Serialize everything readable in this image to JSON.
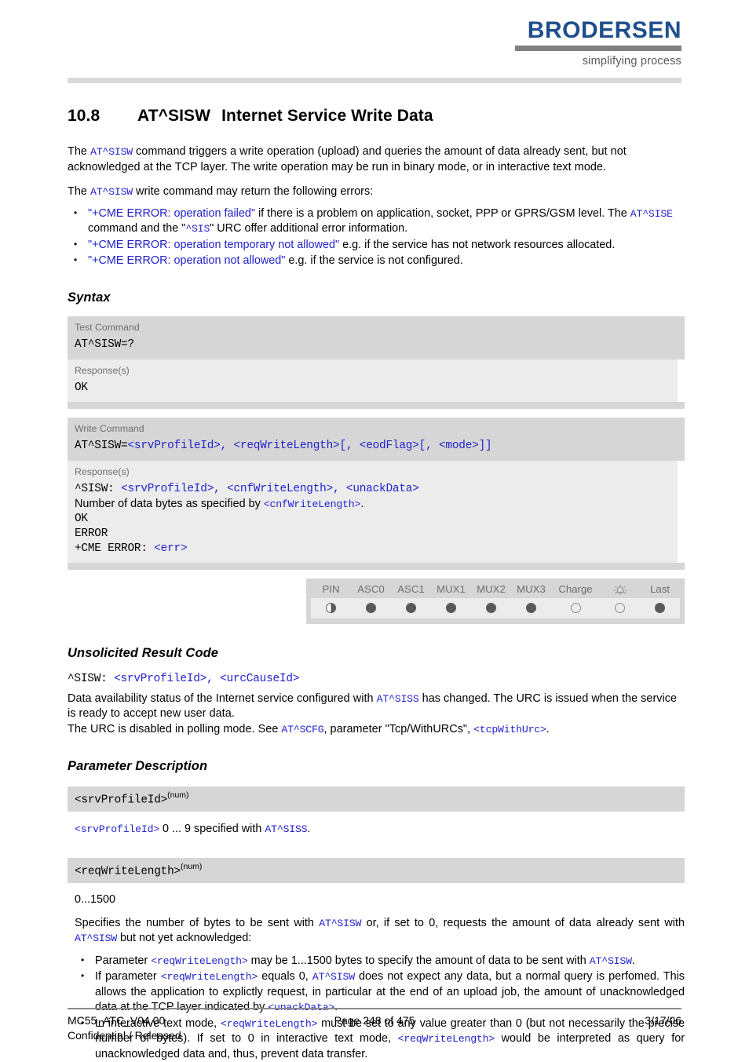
{
  "header": {
    "logo_word": "BRODERSEN",
    "logo_tagline": "simplifying process",
    "logo_color": "#1f4e8c"
  },
  "section": {
    "number": "10.8",
    "command": "AT^SISW",
    "title": "Internet Service Write Data"
  },
  "intro": {
    "p1_a": "The ",
    "p1_code": "AT^SISW",
    "p1_b": " command triggers a write operation (upload) and queries the amount of data already sent, but not acknowledged at the TCP layer. The write operation may be run in binary mode, or in interactive text mode.",
    "p2_a": "The ",
    "p2_code": "AT^SISW",
    "p2_b": " write command may return the following errors:"
  },
  "error_bullets": [
    {
      "quoted": "\"+CME ERROR: operation failed\"",
      "rest": " if there is a problem on application, socket, PPP or GPRS/GSM level. The ",
      "code2": "AT^SISE",
      "rest2": " command and the \"",
      "code3": "^SIS",
      "rest3": "\" URC offer additional error information."
    },
    {
      "quoted": "\"+CME ERROR: operation temporary not allowed\"",
      "rest": " e.g. if the service has not network resources allocated."
    },
    {
      "quoted": "\"+CME ERROR: operation not allowed\"",
      "rest": " e.g. if the service is not configured."
    }
  ],
  "syntax": {
    "heading": "Syntax",
    "test_command": {
      "label": "Test Command",
      "code": "AT^SISW=?",
      "response_label": "Response(s)",
      "response": "OK"
    },
    "write_command": {
      "label": "Write Command",
      "code_prefix": "AT^SISW=",
      "code_params": "<srvProfileId>, <reqWriteLength>[, <eodFlag>[, <mode>]]",
      "response_label": "Response(s)",
      "response_line1_prefix": "^SISW: ",
      "response_line1_params": "<srvProfileId>, <cnfWriteLength>, <unackData>",
      "response_line2_a": "Number of data bytes as specified by ",
      "response_line2_code": "<cnfWriteLength>",
      "response_line2_b": ".",
      "response_line3": "OK",
      "response_line4": "ERROR",
      "response_line5_prefix": "+CME ERROR: ",
      "response_line5_code": "<err>"
    }
  },
  "capability": {
    "columns": [
      {
        "label": "PIN",
        "state": "half"
      },
      {
        "label": "ASC0",
        "state": "full"
      },
      {
        "label": "ASC1",
        "state": "full"
      },
      {
        "label": "MUX1",
        "state": "full"
      },
      {
        "label": "MUX2",
        "state": "full"
      },
      {
        "label": "MUX3",
        "state": "full"
      },
      {
        "label": "Charge",
        "state": "empty"
      },
      {
        "label": "",
        "icon": "alarm-bell-icon",
        "state": "empty"
      },
      {
        "label": "Last",
        "state": "full"
      }
    ]
  },
  "urc": {
    "heading": "Unsolicited Result Code",
    "code_prefix": "^SISW: ",
    "code_params": "<srvProfileId>, <urcCauseId>",
    "desc_a": "Data availability status of the Internet service configured with ",
    "desc_code1": "AT^SISS",
    "desc_b": " has changed. The URC is issued when the service is ready to accept new user data.",
    "desc_c": "The URC is disabled in polling mode. See ",
    "desc_code2": "AT^SCFG",
    "desc_d": ", parameter \"Tcp/WithURCs\", ",
    "desc_code3": "<tcpWithUrc>",
    "desc_e": "."
  },
  "parameters": {
    "heading": "Parameter Description",
    "srv_profile_id": {
      "name": "<srvProfileId>",
      "type_sup": "(num)",
      "desc_code": "<srvProfileId>",
      "desc_a": " 0 ... 9 specified with ",
      "desc_code2": "AT^SISS",
      "desc_b": "."
    },
    "req_write_length": {
      "name": "<reqWriteLength>",
      "type_sup": "(num)",
      "range": "0...1500",
      "desc_a": "Specifies the number of bytes to be sent with ",
      "desc_code1": "AT^SISW",
      "desc_b": " or, if set to 0, requests the amount of data already sent with ",
      "desc_code2": "AT^SISW",
      "desc_c": " but not yet acknowledged:",
      "bullets": [
        {
          "a": "Parameter ",
          "code1": "<reqWriteLength>",
          "b": " may be 1...1500 bytes to specify the amount of data to be sent with ",
          "code2": "AT^SISW",
          "c": "."
        },
        {
          "a": "If parameter ",
          "code1": "<reqWriteLength>",
          "b": " equals 0, ",
          "code2": "AT^SISW",
          "c": " does not expect any data, but a normal query is perfomed. This allows the application to explictly request, in particular at the end of an upload job, the amount of unacknowledged data at the TCP layer indicated by ",
          "code3": "<unackData>",
          "d": "."
        },
        {
          "a": "In interactive text mode, ",
          "code1": "<reqWriteLength>",
          "b": " must be set to any value greater than 0 (but not necessarily the precise number of bytes). If set to 0 in interactive text mode, ",
          "code2": "<reqWriteLength>",
          "c": " would be interpreted as query for unacknowledged data and, thus, prevent data transfer."
        }
      ]
    }
  },
  "footer": {
    "doc_id": "MC55_ATC_V04.00",
    "page": "Page 248 of 475",
    "date": "3/17/06",
    "classification": "Confidential / Released"
  }
}
